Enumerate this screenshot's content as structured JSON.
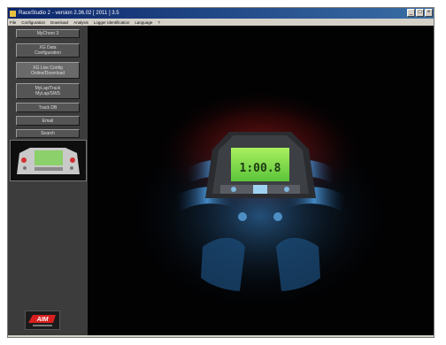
{
  "window": {
    "title": "RaceStudio 2 - version 2.36.02 [ 2011 ] 3.5",
    "controls": {
      "minimize": "_",
      "maximize": "□",
      "close": "×"
    }
  },
  "menu": {
    "items": [
      "File",
      "Configuration",
      "Download",
      "Analysis",
      "Logger Identification",
      "Language",
      "?"
    ]
  },
  "sidebar": {
    "buttons": [
      {
        "line1": "MyChron 3",
        "line2": ""
      },
      {
        "line1": "XG Data",
        "line2": "Configuration"
      },
      {
        "line1": "XG Live Config",
        "line2": "Online/Download"
      },
      {
        "line1": "MyLap/Track",
        "line2": "MyLap/SWS"
      },
      {
        "line1": "Track DB",
        "line2": ""
      },
      {
        "line1": "Email",
        "line2": ""
      },
      {
        "line1": "Search",
        "line2": ""
      }
    ]
  },
  "device": {
    "display_value": "1:00.8"
  },
  "logo": {
    "text": "AIM"
  },
  "colors": {
    "lcd": "#7ee04a",
    "glow_red": "#d22828",
    "glow_blue": "#3f8ed8",
    "title_bar": "#0a246a"
  }
}
